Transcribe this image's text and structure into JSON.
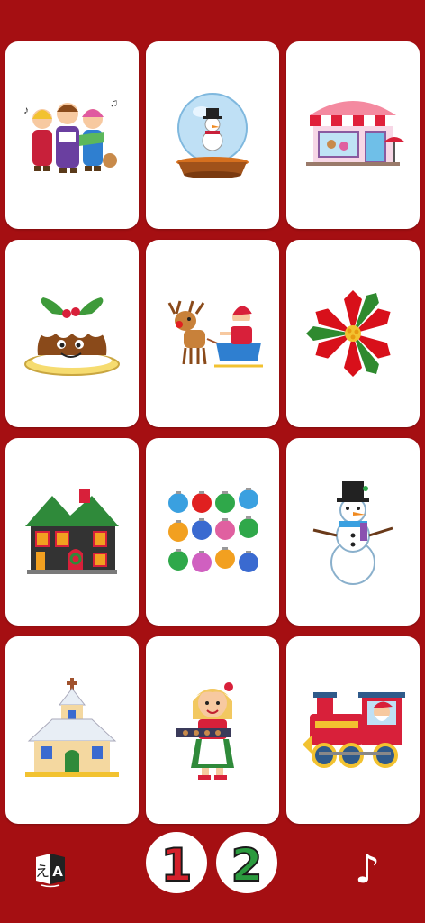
{
  "cards": [
    {
      "icon": "carolers-icon"
    },
    {
      "icon": "snow-globe-icon"
    },
    {
      "icon": "bakery-shop-icon"
    },
    {
      "icon": "christmas-pudding-icon"
    },
    {
      "icon": "santa-sleigh-reindeer-icon"
    },
    {
      "icon": "poinsettia-icon"
    },
    {
      "icon": "gingerbread-house-icon"
    },
    {
      "icon": "ornaments-icon"
    },
    {
      "icon": "snowman-icon"
    },
    {
      "icon": "church-icon"
    },
    {
      "icon": "baker-girl-icon"
    },
    {
      "icon": "santa-train-icon"
    }
  ],
  "bottom_bar": {
    "language_icon": "translate-icon",
    "level_one_label": "1",
    "level_two_label": "2",
    "music_glyph": "♪",
    "level_one_color": "#d3202a",
    "level_two_color": "#2b9a3e"
  },
  "colors": {
    "background": "#a50f12",
    "card": "#ffffff"
  }
}
